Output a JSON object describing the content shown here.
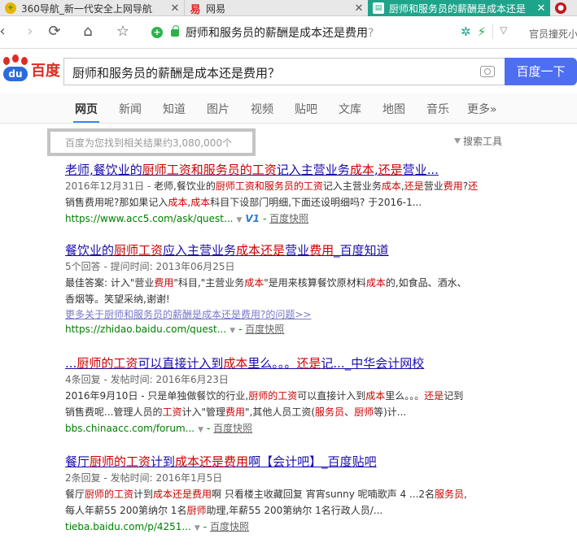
{
  "browser": {
    "tabs": [
      {
        "title": "360导航_新一代安全上网导航",
        "favicon": "360-icon",
        "active": false
      },
      {
        "title": "网易",
        "favicon": "netease-icon",
        "active": false
      },
      {
        "title": "厨师和服务员的薪酬是成本还是",
        "favicon": "tab-page-icon",
        "active": true
      },
      {
        "title": "",
        "favicon": "extra-tab-icon",
        "active": false
      }
    ],
    "address_text": "厨师和服务员的薪酬是成本还是费用",
    "address_suffix": "?",
    "right_hint": "官员撞死小"
  },
  "search": {
    "logo_du": "du",
    "logo_text": "百度",
    "query": "厨师和服务员的薪酬是成本还是费用？",
    "button": "百度一下",
    "tabs": [
      "网页",
      "新闻",
      "知道",
      "图片",
      "视频",
      "贴吧",
      "文库",
      "地图",
      "音乐",
      "更多»"
    ],
    "result_count": "百度为您找到相关结果约3,080,000个",
    "tools": "搜索工具"
  },
  "results": [
    {
      "title": [
        {
          "t": "老师,餐饮业的",
          "em": false
        },
        {
          "t": "厨师工资和服务员的工资",
          "em": true
        },
        {
          "t": "记入主营业务",
          "em": false
        },
        {
          "t": "成本",
          "em": true
        },
        {
          "t": ",",
          "em": false
        },
        {
          "t": "还是",
          "em": true
        },
        {
          "t": "营业...",
          "em": false
        }
      ],
      "lines": [
        [
          {
            "t": "2016年12月31日 - ",
            "c": "gray"
          },
          {
            "t": "老师,餐饮业的",
            "c": ""
          },
          {
            "t": "厨师工资和服务员的工资",
            "c": "em"
          },
          {
            "t": "记入主营业务",
            "c": ""
          },
          {
            "t": "成本",
            "c": "em"
          },
          {
            "t": ",",
            "c": ""
          },
          {
            "t": "还是",
            "c": "em"
          },
          {
            "t": "营业",
            "c": ""
          },
          {
            "t": "费用",
            "c": "em"
          },
          {
            "t": "?",
            "c": ""
          },
          {
            "t": "还",
            "c": "em"
          }
        ],
        [
          {
            "t": "销售费用呢?那如果记入",
            "c": ""
          },
          {
            "t": "成本",
            "c": "em"
          },
          {
            "t": ",",
            "c": ""
          },
          {
            "t": "成本",
            "c": "em"
          },
          {
            "t": "科目下设部门明细,下面还设明细吗? 于2016-1...",
            "c": ""
          }
        ]
      ],
      "more": "",
      "url": "https://www.acc5.com/ask/quest...",
      "v_badge": "V1",
      "snapshot": "百度快照"
    },
    {
      "title": [
        {
          "t": "餐饮业的",
          "em": false
        },
        {
          "t": "厨师工资",
          "em": true
        },
        {
          "t": "应入主营业务",
          "em": false
        },
        {
          "t": "成本还是",
          "em": true
        },
        {
          "t": "营业",
          "em": false
        },
        {
          "t": "费用",
          "em": true
        },
        {
          "t": "_百度知道",
          "em": false
        }
      ],
      "lines": [
        [
          {
            "t": "5个回答 - 提问时间: 2013年06月25日",
            "c": "gray"
          }
        ],
        [
          {
            "t": "最佳答案: 计入\"营业",
            "c": ""
          },
          {
            "t": "费用",
            "c": "em"
          },
          {
            "t": "\"科目,\"主营业务",
            "c": ""
          },
          {
            "t": "成本",
            "c": "em"
          },
          {
            "t": "\"是用来核算餐饮原材料",
            "c": ""
          },
          {
            "t": "成本",
            "c": "em"
          },
          {
            "t": "的,如食品、酒水、",
            "c": ""
          }
        ],
        [
          {
            "t": "香烟等。笑望采纳,谢谢!",
            "c": ""
          }
        ]
      ],
      "more": "更多关于厨师和服务员的薪酬是成本还是费用?的问题>>",
      "url": "https://zhidao.baidu.com/quest...",
      "v_badge": "",
      "snapshot": "百度快照"
    },
    {
      "title": [
        {
          "t": "...",
          "em": false
        },
        {
          "t": "厨师的工资",
          "em": true
        },
        {
          "t": "可以直接计入到",
          "em": false
        },
        {
          "t": "成本",
          "em": true
        },
        {
          "t": "里么。。。",
          "em": false
        },
        {
          "t": "还是",
          "em": true
        },
        {
          "t": "记..._中华会计网校",
          "em": false
        }
      ],
      "lines": [
        [
          {
            "t": "4条回复 - 发帖时间: 2016年6月23日",
            "c": "gray"
          }
        ],
        [
          {
            "t": "2016年9月10日 - 只是单独做餐饮的行业,",
            "c": ""
          },
          {
            "t": "厨师的工资",
            "c": "em"
          },
          {
            "t": "可以直接计入到",
            "c": ""
          },
          {
            "t": "成本",
            "c": "em"
          },
          {
            "t": "里么。。。",
            "c": ""
          },
          {
            "t": "还是",
            "c": "em"
          },
          {
            "t": "记到",
            "c": ""
          }
        ],
        [
          {
            "t": "销售费呢...管理人员的",
            "c": ""
          },
          {
            "t": "工资",
            "c": "em"
          },
          {
            "t": "计入\"管理",
            "c": ""
          },
          {
            "t": "费用",
            "c": "em"
          },
          {
            "t": "\",其他人员工资(",
            "c": ""
          },
          {
            "t": "服务员",
            "c": "em"
          },
          {
            "t": "、",
            "c": ""
          },
          {
            "t": "厨师",
            "c": "em"
          },
          {
            "t": "等)计...",
            "c": ""
          }
        ]
      ],
      "more": "",
      "url": "bbs.chinaacc.com/forum...",
      "v_badge": "",
      "snapshot": "百度快照"
    },
    {
      "title": [
        {
          "t": "餐厅",
          "em": false
        },
        {
          "t": "厨师的工资",
          "em": true
        },
        {
          "t": "计到",
          "em": false
        },
        {
          "t": "成本还是费用",
          "em": true
        },
        {
          "t": "啊【会计吧】_百度贴吧",
          "em": false
        }
      ],
      "lines": [
        [
          {
            "t": "2条回复 - 发帖时间: 2016年1月5日",
            "c": "gray"
          }
        ],
        [
          {
            "t": "餐厅",
            "c": ""
          },
          {
            "t": "厨师的工资",
            "c": "em"
          },
          {
            "t": "计到",
            "c": ""
          },
          {
            "t": "成本还是费用",
            "c": "em"
          },
          {
            "t": "啊 只看楼主收藏回复 宵宵sunny 呢喃歌声 4 ...2名",
            "c": ""
          },
          {
            "t": "服务员",
            "c": "em"
          },
          {
            "t": ",",
            "c": ""
          }
        ],
        [
          {
            "t": "每人年薪55 200第纳尔 1名",
            "c": ""
          },
          {
            "t": "厨师",
            "c": "em"
          },
          {
            "t": "助理,年薪55 200第纳尔 1名行政人员/...",
            "c": ""
          }
        ]
      ],
      "more": "",
      "url": "tieba.baidu.com/p/4251...",
      "v_badge": "",
      "snapshot": "百度快照"
    }
  ]
}
